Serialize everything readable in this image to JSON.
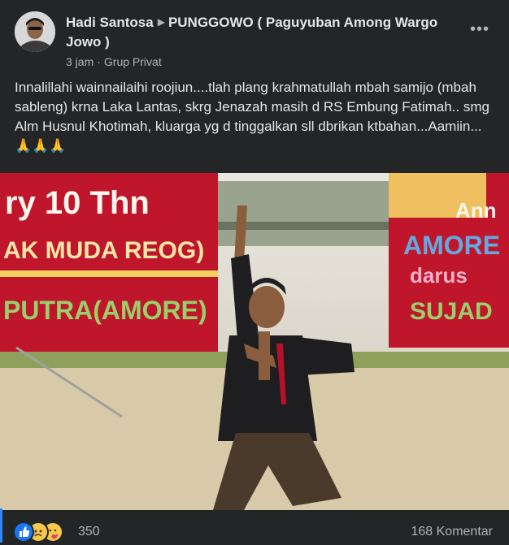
{
  "post": {
    "author": "Hadi Santosa",
    "group": "PUNGGOWO ( Paguyuban Among Wargo Jowo )",
    "time": "3 jam",
    "privacy": "Grup Privat",
    "more_icon": "more-horizontal-icon",
    "text": "Innalillahi wainnailaihi roojiun....tlah plang krahmatullah mbah samijo (mbah sableng) krna Laka Lantas, skrg Jenazah masih d RS Embung Fatimah.. smg Alm Husnul Khotimah, kluarga yg d tinggalkan sll dbrikan ktbahan...Aamiin...🙏🙏🙏"
  },
  "photo": {
    "banner_left": [
      "ry 10 Thn",
      "AK MUDA REOG)",
      "PUTRA(AMORE)"
    ],
    "banner_right": [
      "Ann",
      "AMORE",
      "darus",
      "SUJAD"
    ]
  },
  "footer": {
    "reaction_icons": [
      "like-icon",
      "sad-icon",
      "care-icon"
    ],
    "reaction_count": "350",
    "comments": "168 Komentar"
  },
  "colors": {
    "background": "#242526",
    "text": "#e4e6eb",
    "secondary": "#b0b3b8",
    "accent": "#2d88ff"
  }
}
